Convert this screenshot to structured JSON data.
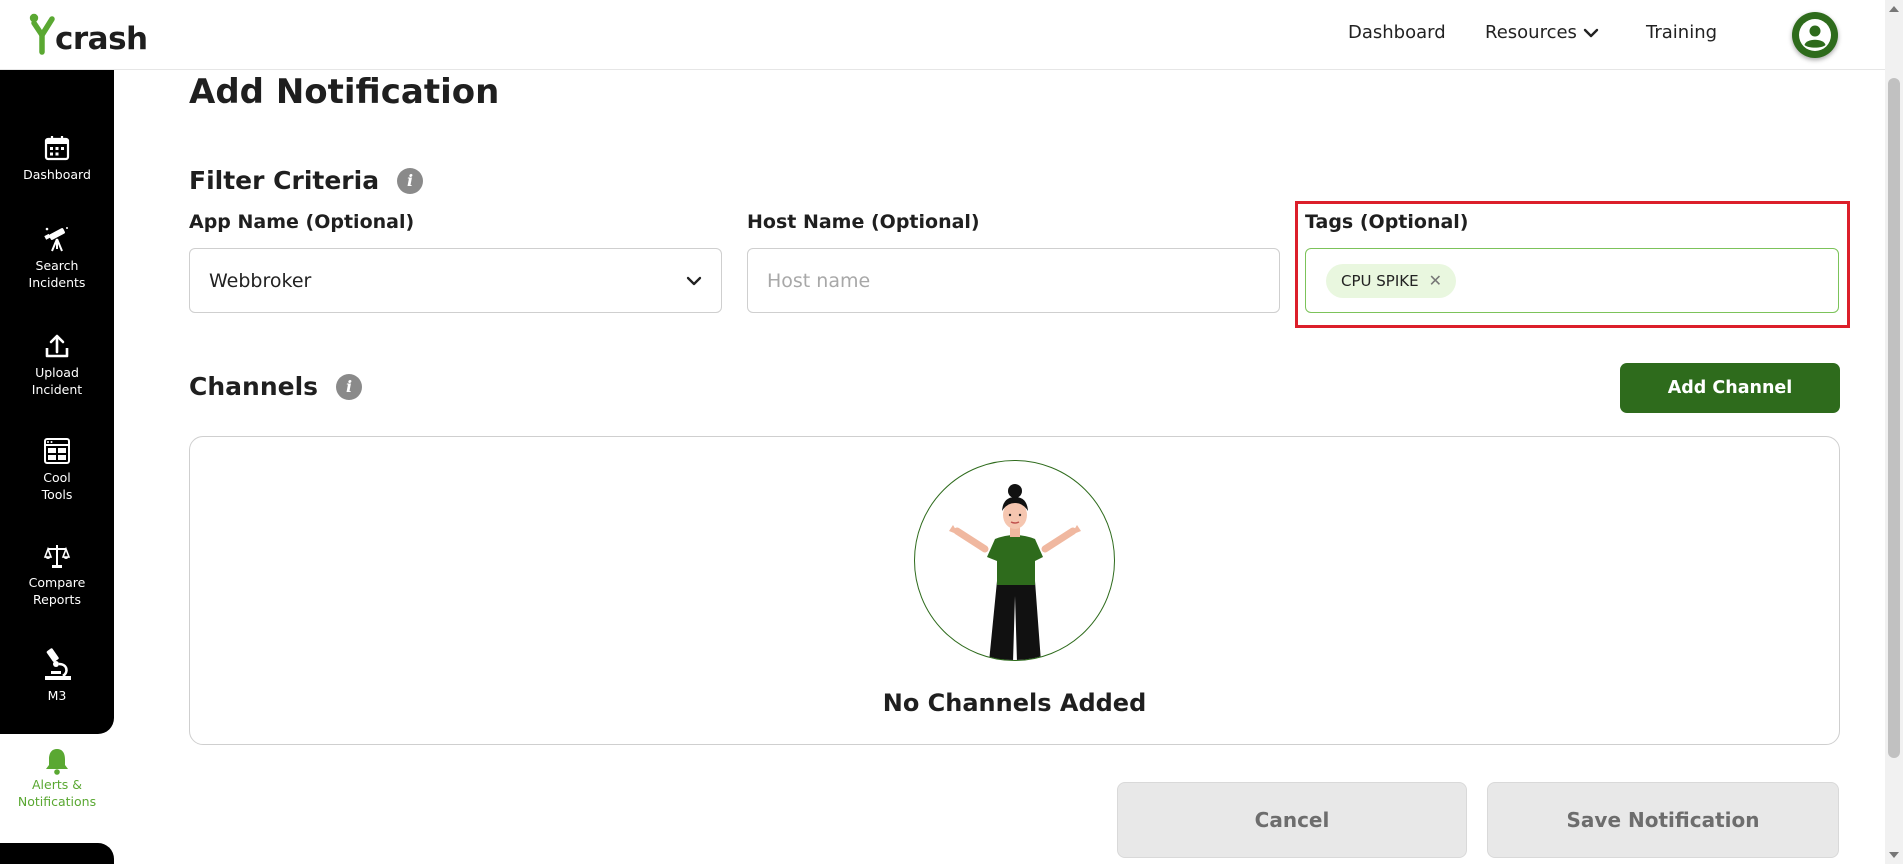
{
  "app": {
    "logo_text": "crash"
  },
  "topnav": {
    "dashboard": "Dashboard",
    "resources": "Resources",
    "training": "Training"
  },
  "sidebar": {
    "items": [
      {
        "label": "Dashboard"
      },
      {
        "label": "Search Incidents"
      },
      {
        "label": "Upload Incident"
      },
      {
        "label": "Cool Tools"
      },
      {
        "label": "Compare Reports"
      },
      {
        "label": "M3"
      },
      {
        "label": "Alerts & Notifications"
      }
    ]
  },
  "page": {
    "title": "Add Notification"
  },
  "filter": {
    "title": "Filter Criteria",
    "app_name_label": "App Name (Optional)",
    "app_name_value": "Webbroker",
    "host_name_label": "Host Name (Optional)",
    "host_name_placeholder": "Host name",
    "tags_label": "Tags (Optional)",
    "tags": [
      "CPU SPIKE"
    ]
  },
  "channels": {
    "title": "Channels",
    "add_button": "Add Channel",
    "empty_text": "No Channels Added"
  },
  "actions": {
    "cancel": "Cancel",
    "save": "Save Notification"
  },
  "colors": {
    "brand_green": "#2e6b1c",
    "accent_green": "#5aa832",
    "highlight_red": "#dc1f2a"
  }
}
